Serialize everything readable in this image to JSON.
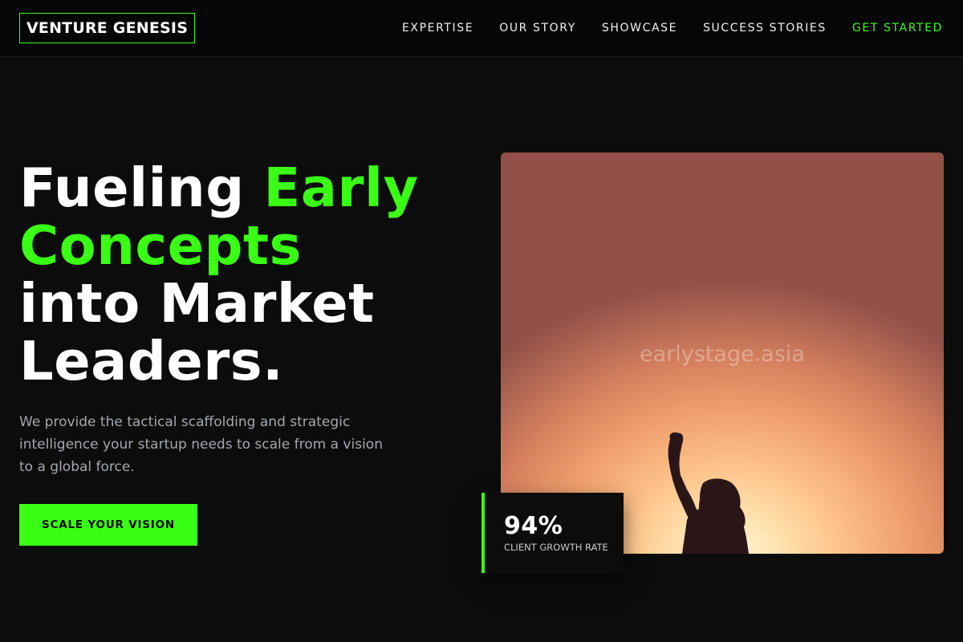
{
  "brand": {
    "name": "VENTURE GENESIS",
    "accent_color": "#39ff14"
  },
  "nav": {
    "links": [
      {
        "label": "EXPERTISE"
      },
      {
        "label": "OUR STORY"
      },
      {
        "label": "SHOWCASE"
      },
      {
        "label": "SUCCESS STORIES"
      }
    ],
    "cta_label": "GET STARTED"
  },
  "hero": {
    "title_line1_white": "Fueling ",
    "title_line1_accent": "Early",
    "title_line2_accent": "Concepts",
    "title_line3": "into Market",
    "title_line4": "Leaders.",
    "subtitle": "We provide the tactical scaffolding and strategic intelligence your startup needs to scale from a vision to a global force.",
    "button_label": "SCALE YOUR VISION",
    "image": {
      "subject": "silhouette-raised-fist-sunset",
      "watermark": "earlystage.asia"
    }
  },
  "stat": {
    "value": "94%",
    "label": "CLIENT GROWTH RATE"
  }
}
